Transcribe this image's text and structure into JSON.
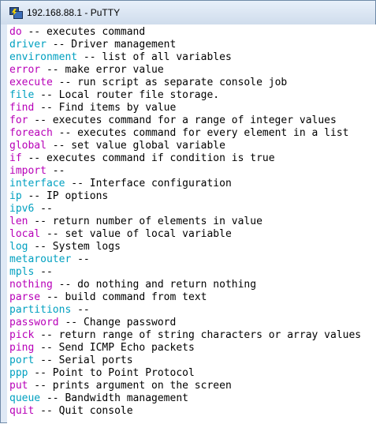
{
  "window": {
    "title": "192.168.88.1 - PuTTY",
    "icon": "putty-icon"
  },
  "colors": {
    "magenta": "#b800b8",
    "cyan": "#00a0c0",
    "text": "#000000",
    "background": "#ffffff"
  },
  "separator": " -- ",
  "lines": [
    {
      "cmd": "do",
      "desc": "executes command",
      "color": "magenta"
    },
    {
      "cmd": "driver",
      "desc": "Driver management",
      "color": "cyan"
    },
    {
      "cmd": "environment",
      "desc": "list of all variables",
      "color": "cyan"
    },
    {
      "cmd": "error",
      "desc": "make error value",
      "color": "magenta"
    },
    {
      "cmd": "execute",
      "desc": "run script as separate console job",
      "color": "magenta"
    },
    {
      "cmd": "file",
      "desc": "Local router file storage.",
      "color": "cyan"
    },
    {
      "cmd": "find",
      "desc": "Find items by value",
      "color": "magenta"
    },
    {
      "cmd": "for",
      "desc": "executes command for a range of integer values",
      "color": "magenta"
    },
    {
      "cmd": "foreach",
      "desc": "executes command for every element in a list",
      "color": "magenta"
    },
    {
      "cmd": "global",
      "desc": "set value global variable",
      "color": "magenta"
    },
    {
      "cmd": "if",
      "desc": "executes command if condition is true",
      "color": "magenta"
    },
    {
      "cmd": "import",
      "desc": "",
      "color": "magenta"
    },
    {
      "cmd": "interface",
      "desc": "Interface configuration",
      "color": "cyan"
    },
    {
      "cmd": "ip",
      "desc": "IP options",
      "color": "cyan"
    },
    {
      "cmd": "ipv6",
      "desc": "",
      "color": "cyan"
    },
    {
      "cmd": "len",
      "desc": "return number of elements in value",
      "color": "magenta"
    },
    {
      "cmd": "local",
      "desc": "set value of local variable",
      "color": "magenta"
    },
    {
      "cmd": "log",
      "desc": "System logs",
      "color": "cyan"
    },
    {
      "cmd": "metarouter",
      "desc": "",
      "color": "cyan"
    },
    {
      "cmd": "mpls",
      "desc": "",
      "color": "cyan"
    },
    {
      "cmd": "nothing",
      "desc": "do nothing and return nothing",
      "color": "magenta"
    },
    {
      "cmd": "parse",
      "desc": "build command from text",
      "color": "magenta"
    },
    {
      "cmd": "partitions",
      "desc": "",
      "color": "cyan"
    },
    {
      "cmd": "password",
      "desc": "Change password",
      "color": "magenta"
    },
    {
      "cmd": "pick",
      "desc": "return range of string characters or array values",
      "color": "magenta"
    },
    {
      "cmd": "ping",
      "desc": "Send ICMP Echo packets",
      "color": "magenta"
    },
    {
      "cmd": "port",
      "desc": "Serial ports",
      "color": "cyan"
    },
    {
      "cmd": "ppp",
      "desc": "Point to Point Protocol",
      "color": "cyan"
    },
    {
      "cmd": "put",
      "desc": "prints argument on the screen",
      "color": "magenta"
    },
    {
      "cmd": "queue",
      "desc": "Bandwidth management",
      "color": "cyan"
    },
    {
      "cmd": "quit",
      "desc": "Quit console",
      "color": "magenta"
    }
  ]
}
